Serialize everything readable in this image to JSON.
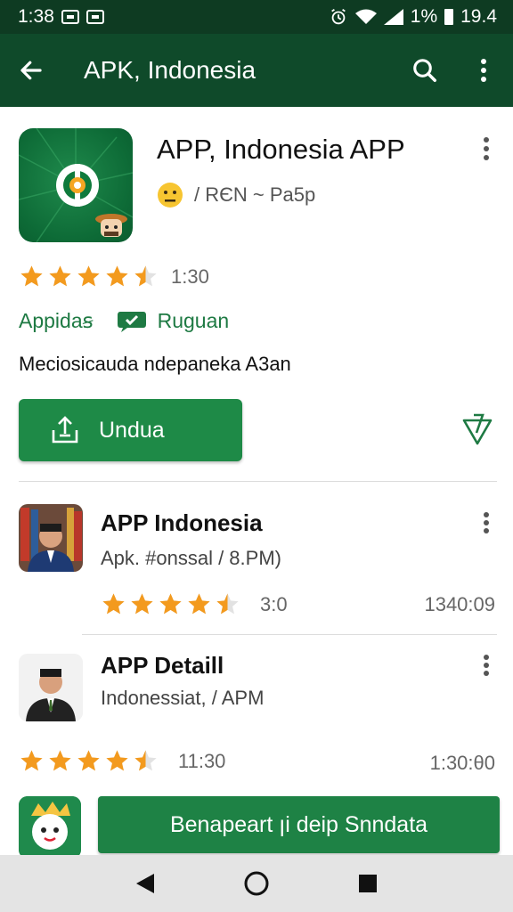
{
  "status_bar": {
    "time": "1:38",
    "battery_percent": "1%",
    "right_time": "19.4"
  },
  "app_bar": {
    "title": "APK, Indonesia"
  },
  "main_app": {
    "title": "APP, Indonesia APP",
    "subtitle": "/ RЄN ~ Pa5p",
    "rating_value": 4.5,
    "rating_text": "1:30",
    "tag1": "Appidaꞩ",
    "tag2": "Ruguan",
    "description": "Meciosicauda ndepaneka A3an",
    "download_label": "Undua"
  },
  "list_items": [
    {
      "title": "APP Indonesia",
      "subtitle": "Apk. #onssal  / 8.PM)",
      "rating_value": 4.5,
      "rating_text": "3:0",
      "time": "1340:09"
    },
    {
      "title": "APP Detaill",
      "subtitle": "Indonessiat,  /  APM",
      "rating_value": 4.5,
      "rating_text": "11:30",
      "time": "1:30:θ0"
    }
  ],
  "banner": {
    "label": "Benapeart ꞁi deip Snndata"
  },
  "colors": {
    "status_bar": "#0e3b22",
    "app_bar": "#0f4a2a",
    "accent": "#1e8a47",
    "star": "#f39a1e"
  },
  "icons": {
    "back": "arrow-left-icon",
    "search": "search-icon",
    "more": "kebab-menu-icon",
    "download": "download-icon",
    "filter": "filter-icon",
    "chat": "chat-check-icon",
    "nav_back": "triangle-back-icon",
    "nav_home": "circle-home-icon",
    "nav_recents": "square-recents-icon"
  }
}
